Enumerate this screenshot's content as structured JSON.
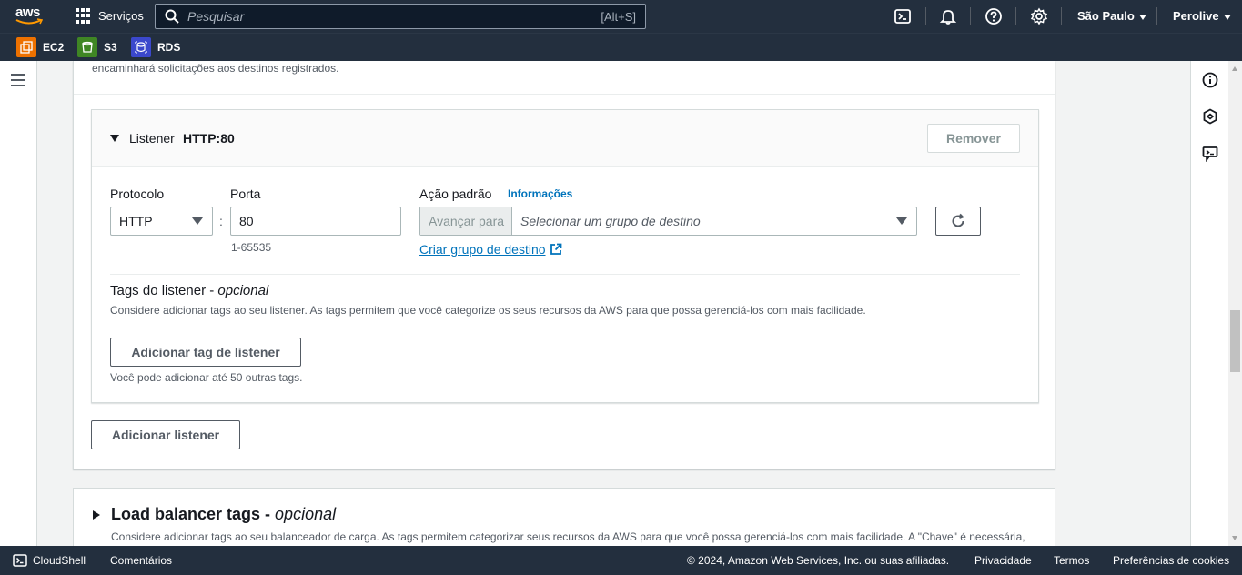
{
  "nav": {
    "logo": "aws",
    "services": "Serviços",
    "search_placeholder": "Pesquisar",
    "search_shortcut": "[Alt+S]",
    "region": "São Paulo",
    "user": "Perolive"
  },
  "favorites": [
    {
      "label": "EC2",
      "color": "#ed7100"
    },
    {
      "label": "S3",
      "color": "#3f8624"
    },
    {
      "label": "RDS",
      "color": "#3b48cc"
    }
  ],
  "section": {
    "intro_text": "encaminhará solicitações aos destinos registrados."
  },
  "listener": {
    "label": "Listener",
    "value": "HTTP:80",
    "remove_button": "Remover",
    "protocol_label": "Protocolo",
    "protocol_value": "HTTP",
    "port_label": "Porta",
    "port_value": "80",
    "port_hint": "1-65535",
    "default_action_label": "Ação padrão",
    "info_link": "Informações",
    "forward_label": "Avançar para",
    "target_group_placeholder": "Selecionar um grupo de destino",
    "create_target_group_link": "Criar grupo de destino",
    "tags_title": "Tags do listener - ",
    "tags_optional": "opcional",
    "tags_description": "Considere adicionar tags ao seu listener. As tags permitem que você categorize os seus recursos da AWS para que possa gerenciá-los com mais facilidade.",
    "add_tag_button": "Adicionar tag de listener",
    "tags_hint": "Você pode adicionar até 50 outras tags."
  },
  "add_listener_button": "Adicionar listener",
  "lb_tags": {
    "title": "Load balancer tags - ",
    "optional": "opcional",
    "description": "Considere adicionar tags ao seu balanceador de carga. As tags permitem categorizar seus recursos da AWS para que você possa gerenciá-los com mais facilidade. A \"Chave\" é necessária,"
  },
  "footer": {
    "cloudshell": "CloudShell",
    "feedback": "Comentários",
    "copyright": "© 2024, Amazon Web Services, Inc. ou suas afiliadas.",
    "privacy": "Privacidade",
    "terms": "Termos",
    "cookies": "Preferências de cookies"
  }
}
